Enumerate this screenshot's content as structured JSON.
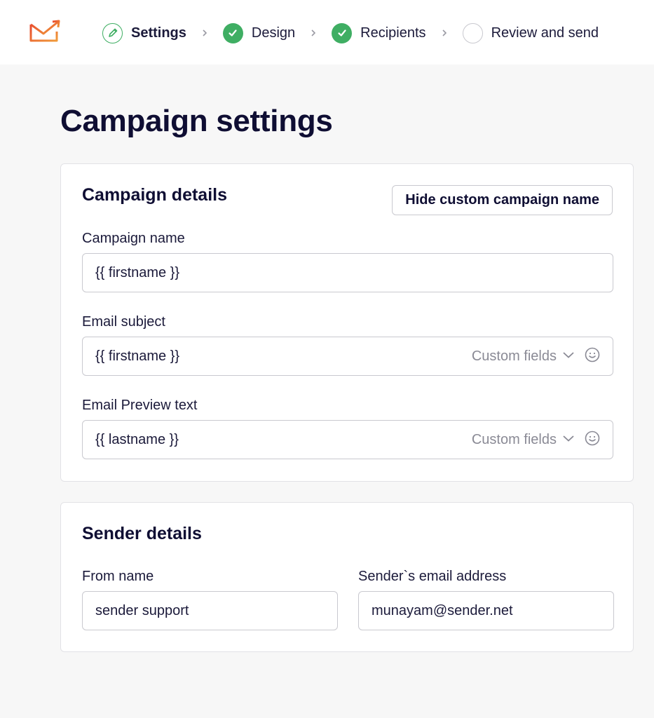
{
  "header": {
    "logo": "sender-envelope-logo",
    "steps": [
      {
        "label": "Settings",
        "state": "active",
        "icon": "pencil-icon"
      },
      {
        "label": "Design",
        "state": "done",
        "icon": "check-icon"
      },
      {
        "label": "Recipients",
        "state": "done",
        "icon": "check-icon"
      },
      {
        "label": "Review and send",
        "state": "pending",
        "icon": "empty-circle-icon"
      }
    ],
    "separator_icon": "chevron-right-icon"
  },
  "page": {
    "title": "Campaign settings"
  },
  "campaign_details": {
    "title": "Campaign details",
    "hide_button": "Hide custom campaign name",
    "campaign_name": {
      "label": "Campaign name",
      "value": "{{ firstname }}"
    },
    "email_subject": {
      "label": "Email subject",
      "value": "{{ firstname }}",
      "custom_fields": "Custom fields"
    },
    "preview_text": {
      "label": "Email Preview text",
      "value": "{{ lastname }}",
      "custom_fields": "Custom fields"
    }
  },
  "sender_details": {
    "title": "Sender details",
    "from_name": {
      "label": "From name",
      "value": "sender support"
    },
    "email": {
      "label": "Sender`s email address",
      "value": "munayam@sender.net"
    }
  },
  "colors": {
    "accent_green": "#3fae63",
    "logo_orange": "#e8472e",
    "text_dark": "#0f0e33",
    "muted": "#8a8a95"
  }
}
